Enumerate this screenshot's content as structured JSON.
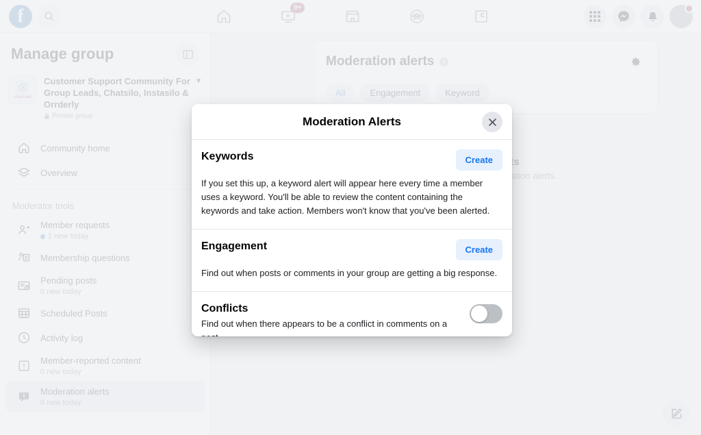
{
  "topbar": {
    "logo_letter": "f",
    "search_icon": "search-icon",
    "nav_items": [
      {
        "icon": "home-icon",
        "badge": ""
      },
      {
        "icon": "video-icon",
        "badge": "9+"
      },
      {
        "icon": "marketplace-icon",
        "badge": ""
      },
      {
        "icon": "groups-icon",
        "badge": ""
      },
      {
        "icon": "gaming-icon",
        "badge": ""
      }
    ],
    "right_items": [
      {
        "icon": "grid-menu-icon"
      },
      {
        "icon": "messenger-icon"
      },
      {
        "icon": "bell-icon"
      },
      {
        "icon": "profile-avatar"
      }
    ]
  },
  "sidebar": {
    "title": "Manage group",
    "panel_toggle_icon": "panel-collapse-icon",
    "group": {
      "thumb_label": "roupLead",
      "name": "Customer Support Community For Group Leads, Chatsilo, Instasilo & Orrderly",
      "privacy": "Private group",
      "privacy_icon": "lock-icon",
      "caret_icon": "chevron-down-icon"
    },
    "top_items": [
      {
        "label": "Community home",
        "icon": "home-outline-icon",
        "sub": ""
      },
      {
        "label": "Overview",
        "icon": "layers-icon",
        "sub": ""
      }
    ],
    "section_label": "Moderator tools",
    "section_caret_icon": "chevron-up-icon",
    "tool_items": [
      {
        "label": "Member requests",
        "icon": "member-request-icon",
        "sub": "1 new today",
        "dot": true,
        "active": false
      },
      {
        "label": "Membership questions",
        "icon": "questions-icon",
        "sub": "",
        "dot": false,
        "active": false
      },
      {
        "label": "Pending posts",
        "icon": "pending-posts-icon",
        "sub": "0 new today",
        "dot": false,
        "active": false
      },
      {
        "label": "Scheduled Posts",
        "icon": "calendar-icon",
        "sub": "",
        "dot": false,
        "active": false
      },
      {
        "label": "Activity log",
        "icon": "clock-icon",
        "sub": "",
        "dot": false,
        "active": false
      },
      {
        "label": "Member-reported content",
        "icon": "report-icon",
        "sub": "0 new today",
        "dot": false,
        "active": false
      },
      {
        "label": "Moderation alerts",
        "icon": "alert-chat-icon",
        "sub": "0 new today",
        "dot": false,
        "active": true
      }
    ]
  },
  "main": {
    "card_title": "Moderation alerts",
    "info_icon": "info-icon",
    "gear_icon": "gear-icon",
    "chips": [
      {
        "label": "All",
        "selected": true
      },
      {
        "label": "Engagement",
        "selected": false
      },
      {
        "label": "Keyword",
        "selected": false
      }
    ],
    "empty_title": "No new alerts",
    "empty_sub": "You have no new moderation alerts.",
    "fab_icon": "compose-icon"
  },
  "modal": {
    "title": "Moderation Alerts",
    "close_icon": "close-icon",
    "sections": [
      {
        "heading": "Keywords",
        "body": "If you set this up, a keyword alert will appear here every time a member uses a keyword. You'll be able to review the content containing the keywords and take action. Members won't know that you've been alerted.",
        "action": "Create",
        "control": "button"
      },
      {
        "heading": "Engagement",
        "body": "Find out when posts or comments in your group are getting a big response.",
        "action": "Create",
        "control": "button"
      },
      {
        "heading": "Conflicts",
        "body": "Find out when there appears to be a conflict in comments on a post",
        "action": "",
        "control": "toggle",
        "toggle_on": false
      }
    ]
  },
  "colors": {
    "brand_blue": "#1877f2",
    "link_blue": "#1b74e4",
    "create_bg": "#e7f0fd",
    "page_bg": "#f0f2f5",
    "badge_red": "#e41e3f",
    "toggle_off": "#bcc0c4"
  }
}
